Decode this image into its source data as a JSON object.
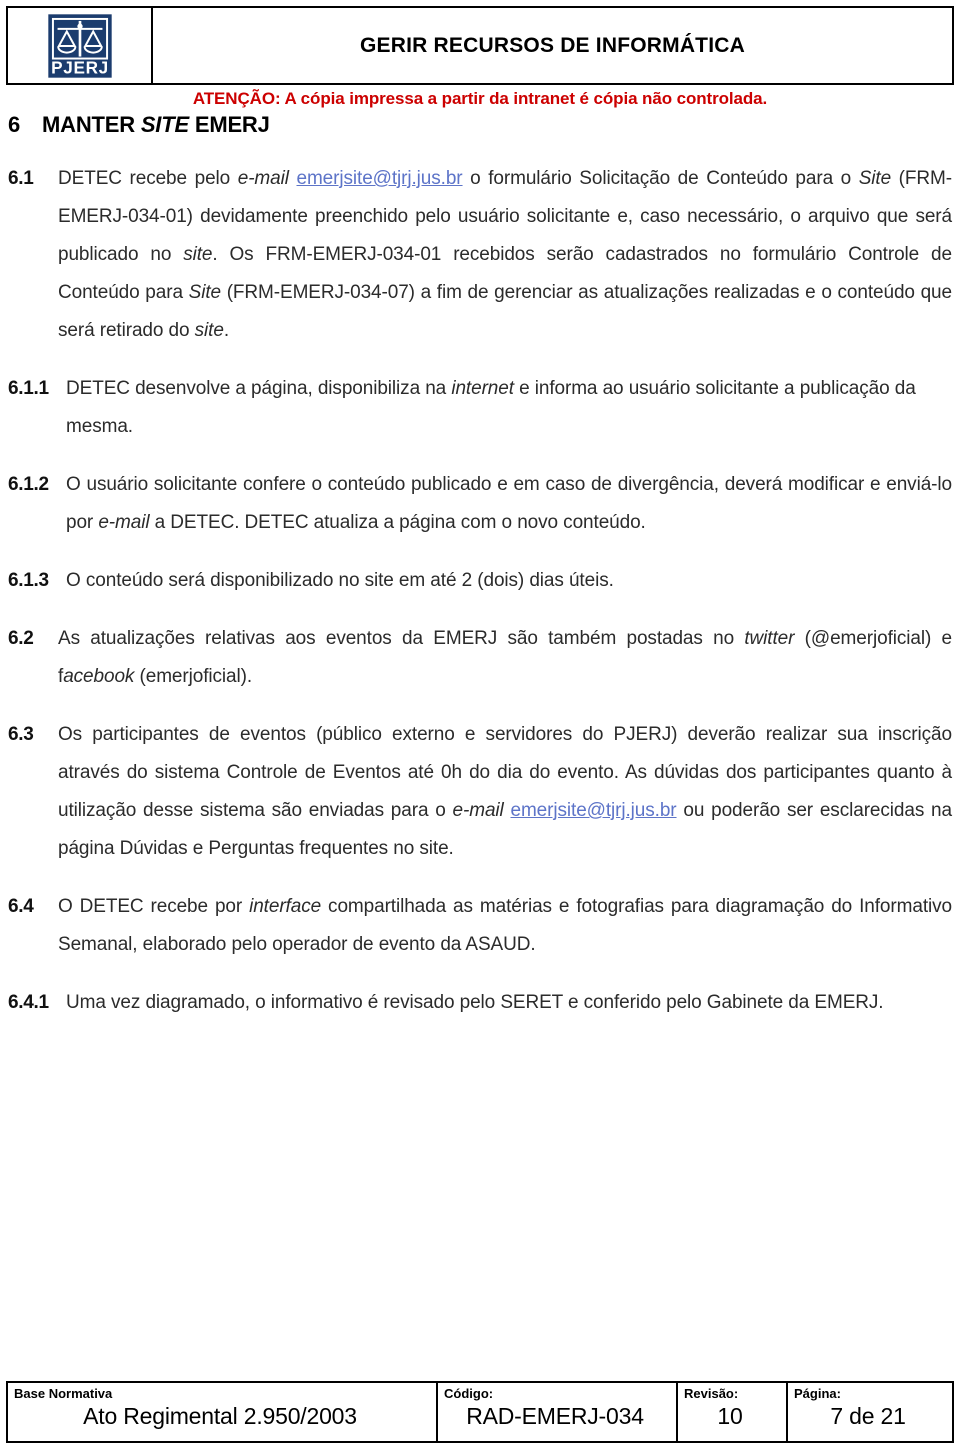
{
  "header": {
    "logo_alt": "PJERJ",
    "logo_text": "PJERJ",
    "title": "GERIR RECURSOS DE INFORMÁTICA",
    "warning": "ATENÇÃO: A cópia impressa a partir da intranet é cópia não controlada."
  },
  "heading": {
    "number": "6",
    "text_before": "MANTER ",
    "text_italic": "SITE",
    "text_after": " EMERJ"
  },
  "clauses": {
    "c61": {
      "number": "6.1",
      "p1": "DETEC recebe pelo ",
      "i1": "e-mail",
      "link": "emerjsite@tjrj.jus.br",
      "p2": " o formulário Solicitação de Conteúdo para o ",
      "i2": "Site",
      "p3": " (FRM-EMERJ-034-01) devidamente preenchido pelo usuário solicitante e, caso necessário, o arquivo que será publicado no ",
      "i3": "site",
      "p4": ". Os FRM-EMERJ-034-01 recebidos serão cadastrados no formulário Controle de Conteúdo para ",
      "i4": "Site",
      "p5": " (FRM-EMERJ-034-07) a fim de gerenciar as atualizações realizadas e o conteúdo que será retirado do ",
      "i5": "site",
      "p6": "."
    },
    "c611": {
      "number": "6.1.1",
      "p1": "DETEC desenvolve a página, disponibiliza na ",
      "i1": "internet",
      "p2": " e informa ao usuário solicitante a publicação da mesma."
    },
    "c612": {
      "number": "6.1.2",
      "p1": "O usuário solicitante confere o conteúdo publicado e em caso de divergência, deverá modificar e enviá-lo por ",
      "i1": "e-mail",
      "p2": " a DETEC. DETEC atualiza a página com o novo conteúdo."
    },
    "c613": {
      "number": "6.1.3",
      "p1": "O conteúdo será disponibilizado no site em até 2 (dois) dias úteis."
    },
    "c62": {
      "number": "6.2",
      "p1": "As atualizações relativas aos eventos da EMERJ são também postadas no ",
      "i1": "twitter",
      "p2": " (@emerjoficial) e f",
      "i2": "acebook",
      "p3": " (emerjoficial)."
    },
    "c63": {
      "number": "6.3",
      "p1": "Os participantes de eventos (público externo e servidores do PJERJ) deverão realizar sua inscrição através do sistema Controle de Eventos até 0h do dia do evento. As dúvidas dos participantes quanto à utilização desse sistema são enviadas para o ",
      "i1": "e-mail",
      "link": "emerjsite@tjrj.jus.br",
      "p2": " ou poderão ser esclarecidas na página Dúvidas e Perguntas frequentes no site."
    },
    "c64": {
      "number": "6.4",
      "p1": "O DETEC recebe por ",
      "i1": "interface",
      "p2": " compartilhada as matérias e fotografias para diagramação do Informativo Semanal, elaborado pelo operador de evento da ASAUD."
    },
    "c641": {
      "number": "6.4.1",
      "p1": "Uma vez diagramado, o informativo é revisado pelo SERET e conferido pelo Gabinete da EMERJ."
    }
  },
  "footer": {
    "base_label": "Base Normativa",
    "base_value": "Ato Regimental 2.950/2003",
    "codigo_label": "Código:",
    "codigo_value": "RAD-EMERJ-034",
    "revisao_label": "Revisão:",
    "revisao_value": "10",
    "pagina_label": "Página:",
    "pagina_value": "7 de 21"
  },
  "colors": {
    "warning_red": "#cc0000",
    "link_blue": "#5d74c8",
    "logo_blue": "#1b3c6e"
  }
}
